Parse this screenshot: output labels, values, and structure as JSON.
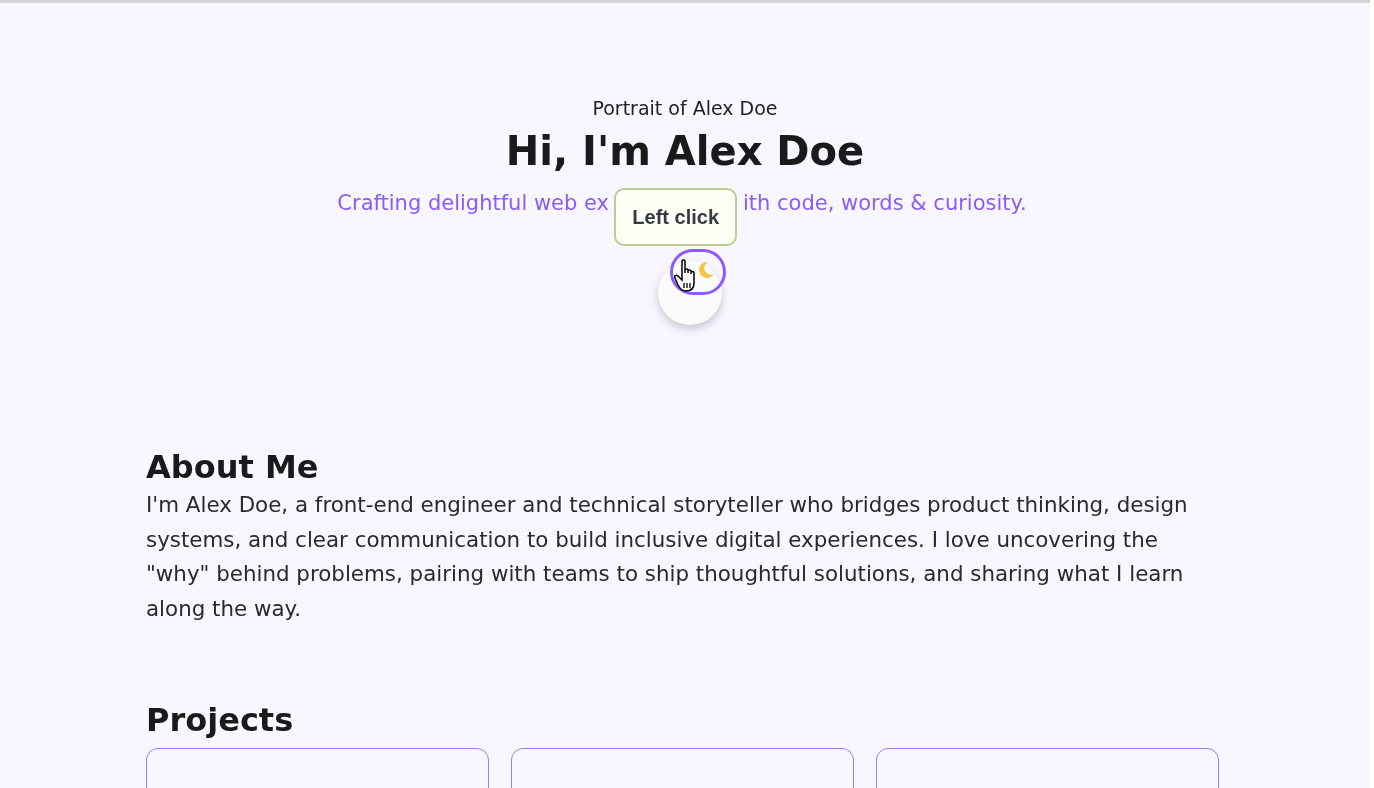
{
  "hero": {
    "portrait_alt": "Portrait of Alex Doe",
    "title": "Hi, I'm Alex Doe",
    "tagline_parts": [
      "Crafting delightful web ex",
      "ith code, words & curiosity."
    ]
  },
  "tooltip": {
    "text": "Left click"
  },
  "about": {
    "heading": "About Me",
    "body": "I'm Alex Doe, a front-end engineer and technical storyteller who bridges product thinking, design systems, and clear communication to build inclusive digital experiences. I love uncovering the \"why\" behind problems, pairing with teams to ship thoughtful solutions, and sharing what I learn along the way."
  },
  "projects": {
    "heading": "Projects",
    "cards": [
      {
        "kind": "card"
      },
      {
        "kind": "card"
      },
      {
        "kind": "card"
      }
    ]
  }
}
